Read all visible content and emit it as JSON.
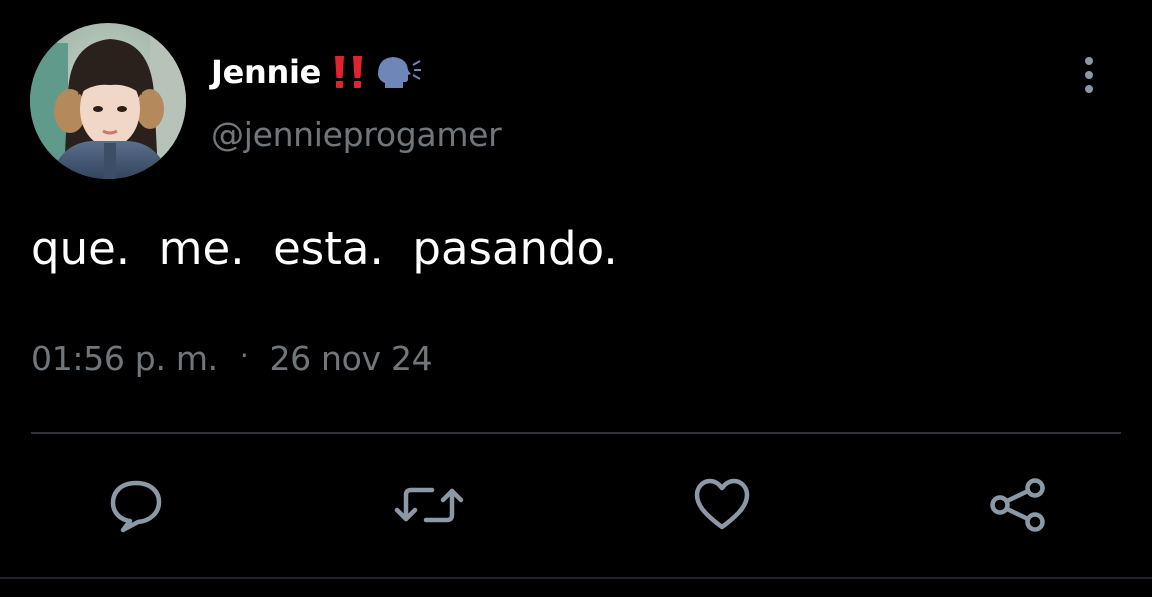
{
  "author": {
    "display_name": "Jennie",
    "handle": "@jennieprogamer",
    "name_icons": [
      "double-exclamation-icon",
      "speaking-head-icon"
    ]
  },
  "tweet": {
    "text": "que.  me.  esta.  pasando."
  },
  "meta": {
    "time": "01:56 p. m.",
    "separator": "·",
    "date": "26 nov 24"
  },
  "actions": [
    {
      "name": "reply",
      "icon": "reply-icon"
    },
    {
      "name": "retweet",
      "icon": "retweet-icon"
    },
    {
      "name": "like",
      "icon": "heart-icon"
    },
    {
      "name": "share",
      "icon": "share-icon"
    }
  ],
  "colors": {
    "background": "#000000",
    "primary_text": "#ffffff",
    "secondary_text": "#71767b",
    "icon": "#8b98a5",
    "divider": "#2f3336",
    "exclamation": "#e0242e",
    "speaking_head": "#6e86b8"
  }
}
